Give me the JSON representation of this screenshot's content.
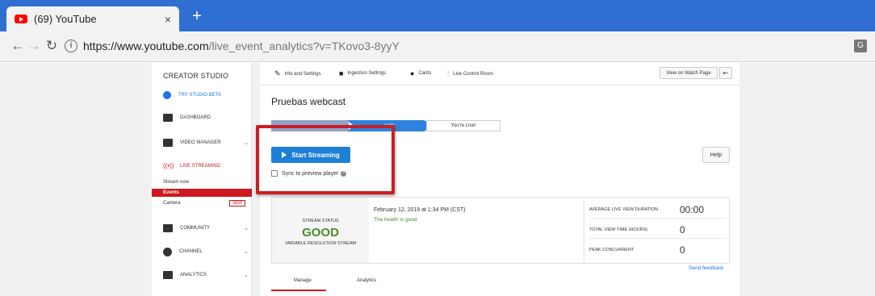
{
  "browser": {
    "tab_title": "(69) YouTube",
    "tab_close": "×",
    "new_tab": "+",
    "url_domain": "https://www.youtube.com",
    "url_path": "/live_event_analytics?v=TKovo3-8yyY"
  },
  "sidebar": {
    "title": "CREATOR STUDIO",
    "try_beta": "TRY STUDIO BETA",
    "dashboard": "DASHBOARD",
    "video_manager": "VIDEO MANAGER",
    "live_streaming": "LIVE STREAMING",
    "stream_now": "Stream now",
    "events": "Events",
    "camera": "Camera",
    "new_badge": "NEW",
    "community": "COMMUNITY",
    "channel": "CHANNEL",
    "analytics": "ANALYTICS",
    "chevron": "⌄"
  },
  "toolbar": {
    "info_settings": "Info and Settings",
    "ingestion_settings": "Ingestion Settings",
    "cards": "Cards",
    "live_control_room": "Live Control Room",
    "view_on_watch_page": "View on Watch Page"
  },
  "main": {
    "title": "Pruebas webcast",
    "step2": "eam",
    "step3": "You're Live!",
    "start_streaming": "Start Streaming",
    "sync_preview": "Sync to preview player",
    "help": "Help"
  },
  "status": {
    "label": "STREAM STATUS",
    "value": "GOOD",
    "sub": "VARIABLE RESOLUTION STREAM",
    "date": "February 12, 2019 at 1:34 PM (CST)",
    "health": "The health is good.",
    "metrics": [
      {
        "label": "AVERAGE LIVE VIEW DURATION",
        "value": "00:00"
      },
      {
        "label": "TOTAL VIEW TIME (HOURS)",
        "value": "0"
      },
      {
        "label": "PEAK CONCURRENT",
        "value": "0"
      }
    ]
  },
  "footer": {
    "send_feedback": "Send feedback",
    "manage": "Manage",
    "analytics": "Analytics"
  },
  "colors": {
    "chrome_blue": "#2f6fd2",
    "youtube_red": "#cc181e",
    "start_blue": "#1e7fd7",
    "good_green": "#4a8c2a",
    "highlight_red": "#cc1e23"
  }
}
